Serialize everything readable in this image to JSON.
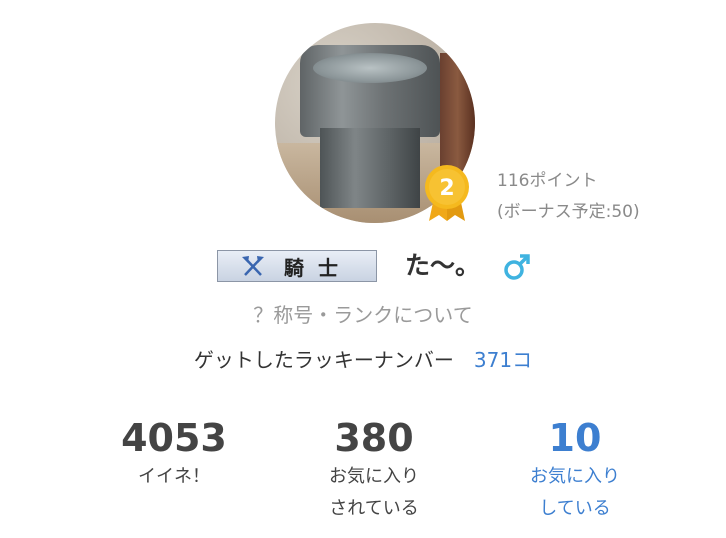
{
  "points": {
    "line1": "116ポイント",
    "line2": "(ボーナス予定:50)"
  },
  "badge": {
    "rank_number": "2"
  },
  "profile": {
    "title": "騎士",
    "username": "た〜。",
    "gender_icon": "male-icon"
  },
  "rank_link": "？称号・ランクについて",
  "lucky": {
    "label": "ゲットしたラッキーナンバー",
    "count": "371コ"
  },
  "stats": [
    {
      "value": "4053",
      "label": "イイネ！"
    },
    {
      "value": "380",
      "label": "お気に入り\nされている"
    },
    {
      "value": "10",
      "label": "お気に入り\nしている"
    }
  ],
  "colors": {
    "link_blue": "#3d7fd0",
    "badge_gold": "#f5b91e",
    "gender_blue": "#3fb3e0"
  }
}
